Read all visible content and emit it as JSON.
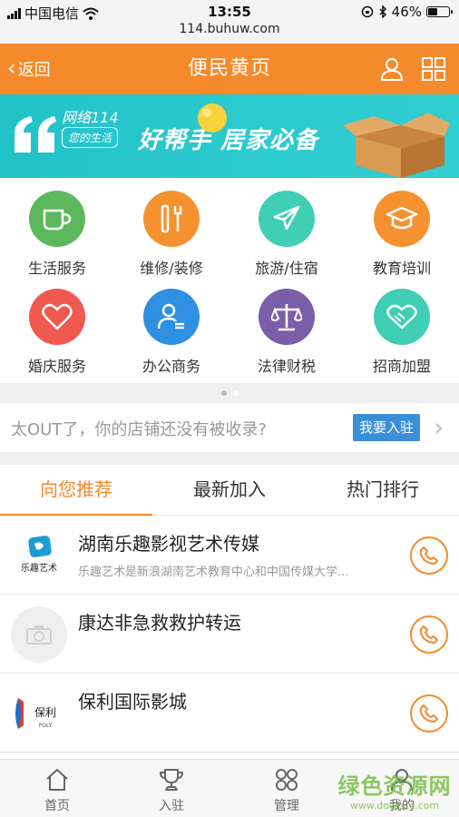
{
  "status_bar": {
    "carrier": "中国电信",
    "time": "13:55",
    "battery": "46%",
    "battery_level": 0.46,
    "url": "114.buhuw.com"
  },
  "header": {
    "back_label": "返回",
    "title": "便民黄页",
    "icons": [
      "user-icon",
      "grid-icon"
    ]
  },
  "banner": {
    "brand": "网络114",
    "sub": "您的生活",
    "slogan": "好帮手 居家必备"
  },
  "categories": [
    {
      "label": "生活服务",
      "color": "#5cb85c",
      "icon": "cup-icon"
    },
    {
      "label": "维修/装修",
      "color": "#f5922f",
      "icon": "tools-icon"
    },
    {
      "label": "旅游/住宿",
      "color": "#3fcfb5",
      "icon": "plane-icon"
    },
    {
      "label": "教育培训",
      "color": "#f5922f",
      "icon": "graduation-cap-icon"
    },
    {
      "label": "婚庆服务",
      "color": "#f0594f",
      "icon": "heart-icon"
    },
    {
      "label": "办公商务",
      "color": "#2f8fe0",
      "icon": "person-card-icon"
    },
    {
      "label": "法律财税",
      "color": "#7a5ea8",
      "icon": "scales-icon"
    },
    {
      "label": "招商加盟",
      "color": "#3fcfb5",
      "icon": "handshake-icon"
    }
  ],
  "pager": {
    "count": 2,
    "active": 1
  },
  "promo": {
    "text": "太OUT了，你的店铺还没有被收录?",
    "button": "我要入驻"
  },
  "tabs": [
    {
      "label": "向您推荐",
      "active": true
    },
    {
      "label": "最新加入",
      "active": false
    },
    {
      "label": "热门排行",
      "active": false
    }
  ],
  "list": [
    {
      "name": "湖南乐趣影视艺术传媒",
      "desc": "乐趣艺术是新浪湖南艺术教育中心和中国传媒大学...",
      "thumb": "lequ-logo"
    },
    {
      "name": "康达非急救救护转运",
      "desc": "",
      "thumb": "camera-placeholder-icon"
    },
    {
      "name": "保利国际影城",
      "desc": "",
      "thumb": "poly-cinema-logo"
    }
  ],
  "bottom_nav": [
    {
      "label": "首页",
      "icon": "home-icon"
    },
    {
      "label": "入驻",
      "icon": "trophy-icon"
    },
    {
      "label": "管理",
      "icon": "grid-icon"
    },
    {
      "label": "我的",
      "icon": "user-icon"
    }
  ],
  "watermark": {
    "line1": "绿色资源网",
    "line2": "www.downcc.com"
  },
  "colors": {
    "accent": "#f58a2c",
    "banner": "#2ccbd0",
    "button_blue": "#3b8fd9"
  }
}
